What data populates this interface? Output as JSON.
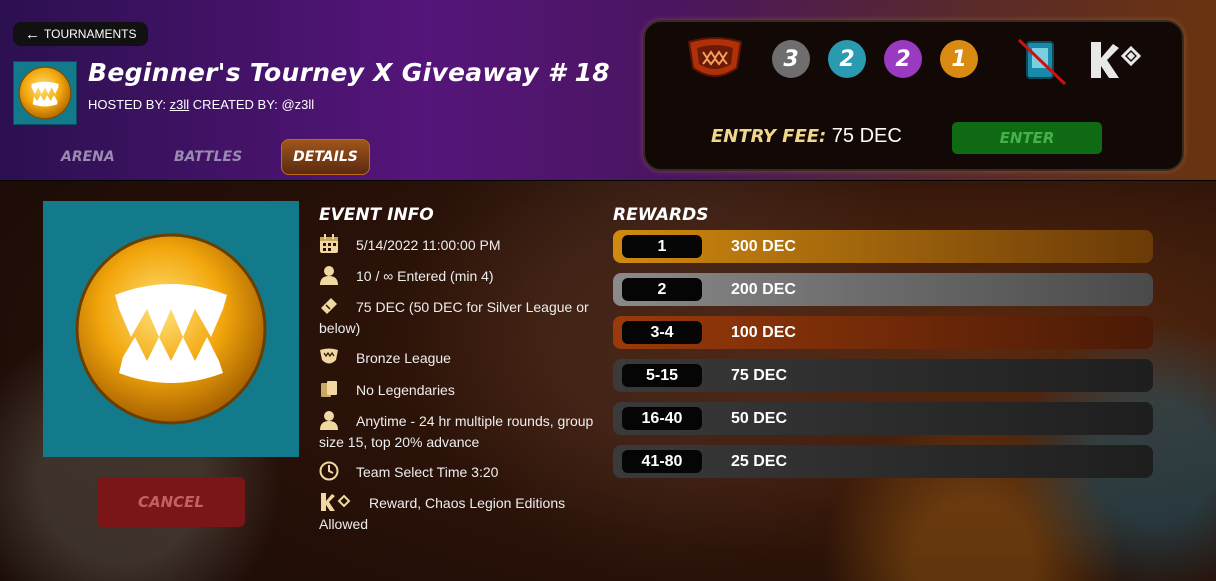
{
  "nav": {
    "back_label": "TOURNAMENTS"
  },
  "tournament": {
    "title": "Beginner's Tourney X Giveaway # 18",
    "hosted_by_label": "HOSTED BY:",
    "host": "z3ll",
    "created_by_label": "CREATED BY:",
    "creator": "@z3ll"
  },
  "tabs": [
    {
      "label": "ARENA",
      "active": false
    },
    {
      "label": "BATTLES",
      "active": false
    },
    {
      "label": "DETAILS",
      "active": true
    }
  ],
  "entry": {
    "levels": [
      {
        "value": "3",
        "color": "#6e6e6e"
      },
      {
        "value": "2",
        "color": "#2a9ab0"
      },
      {
        "value": "2",
        "color": "#9a3ac0"
      },
      {
        "value": "1",
        "color": "#d98a10"
      }
    ],
    "fee_label": "ENTRY FEE:",
    "fee_value": "75 DEC",
    "enter_label": "ENTER"
  },
  "cancel_label": "CANCEL",
  "event_info": {
    "title": "EVENT INFO",
    "items": [
      {
        "icon": "calendar-icon",
        "text": "5/14/2022 11:00:00 PM"
      },
      {
        "icon": "user-icon",
        "text": "10 / ∞ Entered (min 4)"
      },
      {
        "icon": "ticket-icon",
        "text": "75 DEC (50 DEC for Silver League or below)"
      },
      {
        "icon": "league-badge-icon",
        "text": "Bronze League"
      },
      {
        "icon": "cards-icon",
        "text": "No Legendaries"
      },
      {
        "icon": "user-icon",
        "text": "Anytime - 24 hr multiple rounds, group size 15, top 20% advance"
      },
      {
        "icon": "clock-icon",
        "text": "Team Select Time 3:20"
      },
      {
        "icon": "edition-icon",
        "text": "Reward, Chaos Legion Editions Allowed"
      }
    ]
  },
  "rewards": {
    "title": "REWARDS",
    "rows": [
      {
        "rank": "1",
        "prize": "300 DEC",
        "color": "#c07a10"
      },
      {
        "rank": "2",
        "prize": "200 DEC",
        "color": "#8a8a8a"
      },
      {
        "rank": "3-4",
        "prize": "100 DEC",
        "color": "#8a3a10"
      },
      {
        "rank": "5-15",
        "prize": "75 DEC",
        "color": "#333333"
      },
      {
        "rank": "16-40",
        "prize": "50 DEC",
        "color": "#333333"
      },
      {
        "rank": "41-80",
        "prize": "25 DEC",
        "color": "#333333"
      }
    ]
  }
}
